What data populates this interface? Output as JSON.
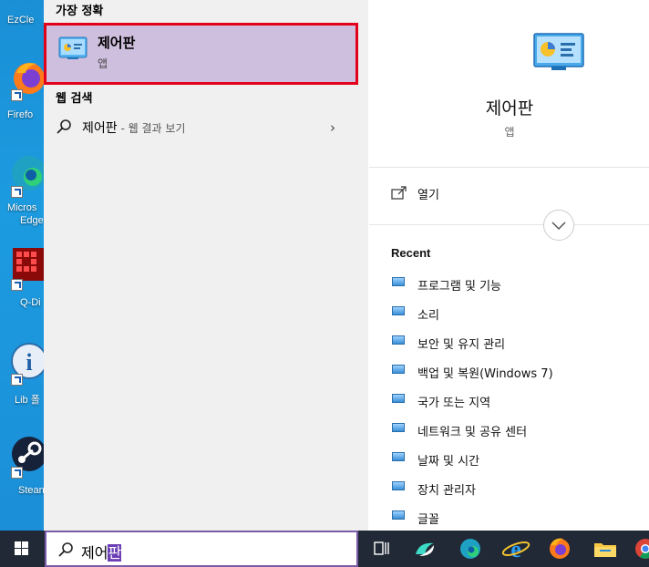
{
  "desktop": {
    "icons": [
      {
        "label": "EzCle",
        "name": "ezcleaner"
      },
      {
        "label": "Firefo",
        "name": "firefox"
      },
      {
        "label": "Micros",
        "name": "edge",
        "label2": "Edge"
      },
      {
        "label": "Q-Di",
        "name": "q-dir"
      },
      {
        "label": "Lib 폴",
        "name": "lib-folder"
      },
      {
        "label": "Stean",
        "name": "steam"
      }
    ]
  },
  "results": {
    "best_match_title": "가장 정확",
    "best": {
      "name": "제어판",
      "type": "앱",
      "icon": "control-panel-icon"
    },
    "web_title": "웹 검색",
    "web": {
      "query": "제어판",
      "hint": " - 웹 결과 보기"
    }
  },
  "detail": {
    "name": "제어판",
    "type": "앱",
    "open_label": "열기",
    "recent_title": "Recent",
    "recent": [
      "프로그램 및 기능",
      "소리",
      "보안 및 유지 관리",
      "백업 및 복원(Windows 7)",
      "국가 또는 지역",
      "네트워크 및 공유 센터",
      "날짜 및 시간",
      "장치 관리자",
      "글꼴"
    ]
  },
  "taskbar": {
    "search_typed": "제어",
    "search_selected": "판",
    "icons": [
      "task-view-icon",
      "app-icon",
      "edge-icon",
      "internet-explorer-icon",
      "firefox-icon",
      "file-explorer-icon",
      "chrome-icon"
    ]
  },
  "colors": {
    "highlight": "#cfbfde",
    "highlight_border": "#e3001b",
    "taskbar": "#202935",
    "search_border": "#7a5ca8"
  }
}
